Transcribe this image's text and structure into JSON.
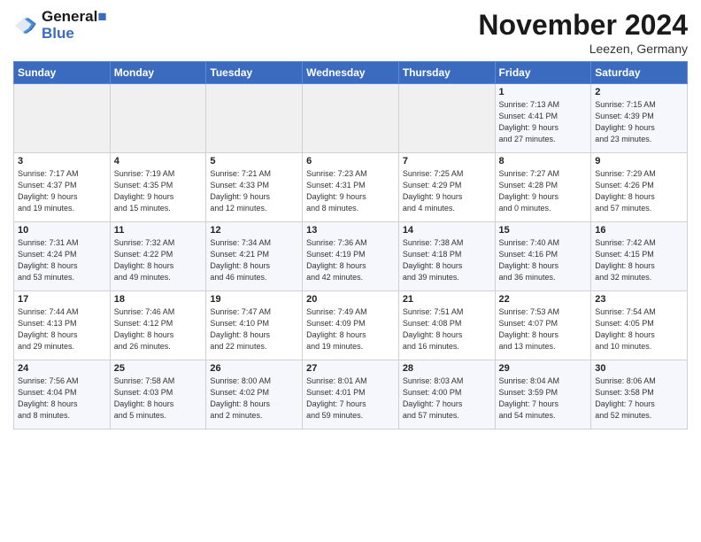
{
  "header": {
    "logo_line1": "General",
    "logo_line2": "Blue",
    "month_title": "November 2024",
    "location": "Leezen, Germany"
  },
  "days_of_week": [
    "Sunday",
    "Monday",
    "Tuesday",
    "Wednesday",
    "Thursday",
    "Friday",
    "Saturday"
  ],
  "weeks": [
    [
      {
        "day": "",
        "info": ""
      },
      {
        "day": "",
        "info": ""
      },
      {
        "day": "",
        "info": ""
      },
      {
        "day": "",
        "info": ""
      },
      {
        "day": "",
        "info": ""
      },
      {
        "day": "1",
        "info": "Sunrise: 7:13 AM\nSunset: 4:41 PM\nDaylight: 9 hours\nand 27 minutes."
      },
      {
        "day": "2",
        "info": "Sunrise: 7:15 AM\nSunset: 4:39 PM\nDaylight: 9 hours\nand 23 minutes."
      }
    ],
    [
      {
        "day": "3",
        "info": "Sunrise: 7:17 AM\nSunset: 4:37 PM\nDaylight: 9 hours\nand 19 minutes."
      },
      {
        "day": "4",
        "info": "Sunrise: 7:19 AM\nSunset: 4:35 PM\nDaylight: 9 hours\nand 15 minutes."
      },
      {
        "day": "5",
        "info": "Sunrise: 7:21 AM\nSunset: 4:33 PM\nDaylight: 9 hours\nand 12 minutes."
      },
      {
        "day": "6",
        "info": "Sunrise: 7:23 AM\nSunset: 4:31 PM\nDaylight: 9 hours\nand 8 minutes."
      },
      {
        "day": "7",
        "info": "Sunrise: 7:25 AM\nSunset: 4:29 PM\nDaylight: 9 hours\nand 4 minutes."
      },
      {
        "day": "8",
        "info": "Sunrise: 7:27 AM\nSunset: 4:28 PM\nDaylight: 9 hours\nand 0 minutes."
      },
      {
        "day": "9",
        "info": "Sunrise: 7:29 AM\nSunset: 4:26 PM\nDaylight: 8 hours\nand 57 minutes."
      }
    ],
    [
      {
        "day": "10",
        "info": "Sunrise: 7:31 AM\nSunset: 4:24 PM\nDaylight: 8 hours\nand 53 minutes."
      },
      {
        "day": "11",
        "info": "Sunrise: 7:32 AM\nSunset: 4:22 PM\nDaylight: 8 hours\nand 49 minutes."
      },
      {
        "day": "12",
        "info": "Sunrise: 7:34 AM\nSunset: 4:21 PM\nDaylight: 8 hours\nand 46 minutes."
      },
      {
        "day": "13",
        "info": "Sunrise: 7:36 AM\nSunset: 4:19 PM\nDaylight: 8 hours\nand 42 minutes."
      },
      {
        "day": "14",
        "info": "Sunrise: 7:38 AM\nSunset: 4:18 PM\nDaylight: 8 hours\nand 39 minutes."
      },
      {
        "day": "15",
        "info": "Sunrise: 7:40 AM\nSunset: 4:16 PM\nDaylight: 8 hours\nand 36 minutes."
      },
      {
        "day": "16",
        "info": "Sunrise: 7:42 AM\nSunset: 4:15 PM\nDaylight: 8 hours\nand 32 minutes."
      }
    ],
    [
      {
        "day": "17",
        "info": "Sunrise: 7:44 AM\nSunset: 4:13 PM\nDaylight: 8 hours\nand 29 minutes."
      },
      {
        "day": "18",
        "info": "Sunrise: 7:46 AM\nSunset: 4:12 PM\nDaylight: 8 hours\nand 26 minutes."
      },
      {
        "day": "19",
        "info": "Sunrise: 7:47 AM\nSunset: 4:10 PM\nDaylight: 8 hours\nand 22 minutes."
      },
      {
        "day": "20",
        "info": "Sunrise: 7:49 AM\nSunset: 4:09 PM\nDaylight: 8 hours\nand 19 minutes."
      },
      {
        "day": "21",
        "info": "Sunrise: 7:51 AM\nSunset: 4:08 PM\nDaylight: 8 hours\nand 16 minutes."
      },
      {
        "day": "22",
        "info": "Sunrise: 7:53 AM\nSunset: 4:07 PM\nDaylight: 8 hours\nand 13 minutes."
      },
      {
        "day": "23",
        "info": "Sunrise: 7:54 AM\nSunset: 4:05 PM\nDaylight: 8 hours\nand 10 minutes."
      }
    ],
    [
      {
        "day": "24",
        "info": "Sunrise: 7:56 AM\nSunset: 4:04 PM\nDaylight: 8 hours\nand 8 minutes."
      },
      {
        "day": "25",
        "info": "Sunrise: 7:58 AM\nSunset: 4:03 PM\nDaylight: 8 hours\nand 5 minutes."
      },
      {
        "day": "26",
        "info": "Sunrise: 8:00 AM\nSunset: 4:02 PM\nDaylight: 8 hours\nand 2 minutes."
      },
      {
        "day": "27",
        "info": "Sunrise: 8:01 AM\nSunset: 4:01 PM\nDaylight: 7 hours\nand 59 minutes."
      },
      {
        "day": "28",
        "info": "Sunrise: 8:03 AM\nSunset: 4:00 PM\nDaylight: 7 hours\nand 57 minutes."
      },
      {
        "day": "29",
        "info": "Sunrise: 8:04 AM\nSunset: 3:59 PM\nDaylight: 7 hours\nand 54 minutes."
      },
      {
        "day": "30",
        "info": "Sunrise: 8:06 AM\nSunset: 3:58 PM\nDaylight: 7 hours\nand 52 minutes."
      }
    ]
  ]
}
